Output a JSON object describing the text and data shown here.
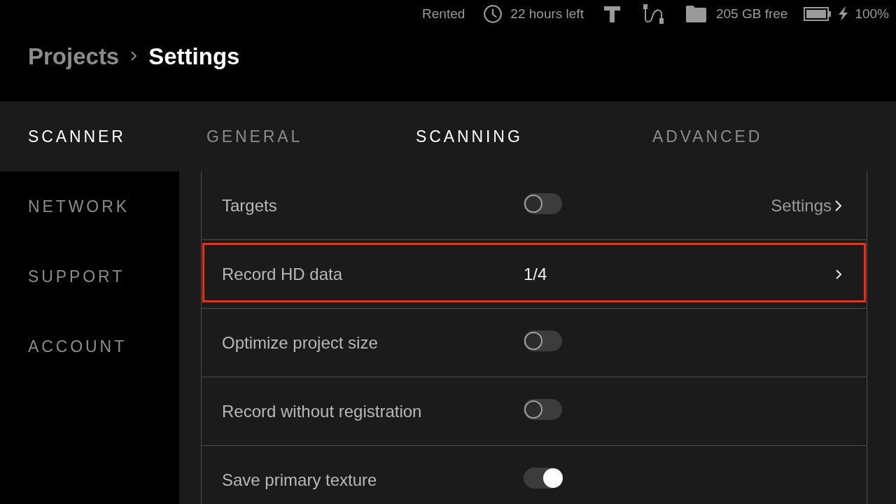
{
  "status_bar": {
    "rental": "Rented",
    "time_left": "22 hours left",
    "storage": "205 GB free",
    "charging": true,
    "battery": "100%"
  },
  "breadcrumb": [
    {
      "label": "Projects",
      "current": false
    },
    {
      "label": "Settings",
      "current": true
    }
  ],
  "sidebar": {
    "items": [
      {
        "label": "SCANNER",
        "selected": true
      },
      {
        "label": "NETWORK",
        "selected": false
      },
      {
        "label": "SUPPORT",
        "selected": false
      },
      {
        "label": "ACCOUNT",
        "selected": false
      }
    ]
  },
  "tabs": [
    {
      "label": "GENERAL",
      "selected": false
    },
    {
      "label": "SCANNING",
      "selected": true
    },
    {
      "label": "ADVANCED",
      "selected": false
    }
  ],
  "rows": [
    {
      "kind": "toggle",
      "label": "Targets",
      "on": false,
      "link": "Settings",
      "highlighted": false
    },
    {
      "kind": "value",
      "label": "Record HD data",
      "value": "1/4",
      "highlighted": true
    },
    {
      "kind": "toggle",
      "label": "Optimize project size",
      "on": false,
      "highlighted": false
    },
    {
      "kind": "toggle",
      "label": "Record without registration",
      "on": false,
      "highlighted": false
    },
    {
      "kind": "toggle",
      "label": "Save primary texture",
      "on": true,
      "highlighted": false
    }
  ]
}
